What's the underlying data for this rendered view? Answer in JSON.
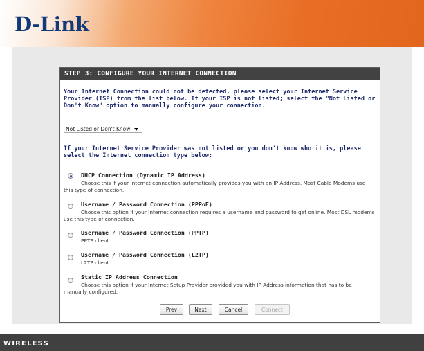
{
  "brand": {
    "logo": "D-Link"
  },
  "step": {
    "title": "STEP 3: CONFIGURE YOUR INTERNET CONNECTION"
  },
  "intro": "Your Internet Connection could not be detected, please select your Internet Service Provider (ISP) from the list below. If your ISP is not listed; select the \"Not Listed or Don't Know\" option to manually configure your connection.",
  "isp_select": {
    "value": "Not Listed or Don't Know"
  },
  "type_prompt": "If your Internet Service Provider was not listed or you don't know who it is, please select the Internet connection type below:",
  "options": [
    {
      "title": "DHCP Connection (Dynamic IP Address)",
      "desc": "Choose this if your Internet connection automatically provides you with an IP Address. Most Cable Modems use this type of connection.",
      "selected": true
    },
    {
      "title": "Username / Password Connection (PPPoE)",
      "desc": "Choose this option if your Internet connection requires a username and password to get online. Most DSL modems use this type of connection.",
      "selected": false
    },
    {
      "title": "Username / Password Connection (PPTP)",
      "desc": "PPTP client.",
      "selected": false
    },
    {
      "title": "Username / Password Connection (L2TP)",
      "desc": "L2TP client.",
      "selected": false
    },
    {
      "title": "Static IP Address Connection",
      "desc": "Choose this option if your Internet Setup Provider provided you with IP Address information that has to be manually configured.",
      "selected": false
    }
  ],
  "buttons": {
    "prev": "Prev",
    "next": "Next",
    "cancel": "Cancel",
    "connect": "Connect"
  },
  "footer": {
    "label": "WIRELESS"
  },
  "colors": {
    "brand_orange": "#e96f26",
    "logo_blue": "#123a7a",
    "title_bar": "#424242",
    "text_blue": "#1f2a6a"
  }
}
